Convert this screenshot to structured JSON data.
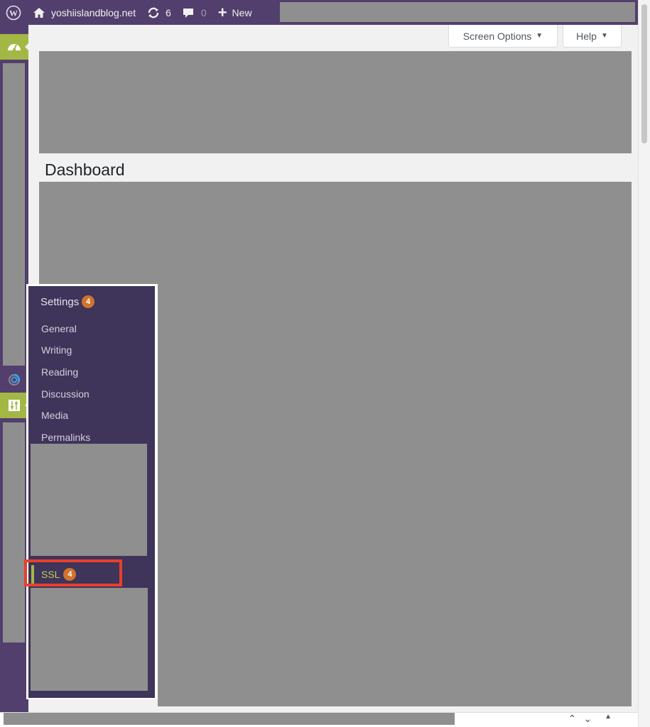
{
  "admin_bar": {
    "wp_logo_icon": "wordpress-logo-icon",
    "site_name": "yoshiislandblog.net",
    "updates_count": "6",
    "comments_count": "0",
    "new_label": "New"
  },
  "screen_meta": {
    "screen_options_label": "Screen Options",
    "help_label": "Help",
    "caret": "▼"
  },
  "page": {
    "title": "Dashboard"
  },
  "flyout": {
    "title": "Settings",
    "title_badge": "4",
    "items": [
      "General",
      "Writing",
      "Reading",
      "Discussion",
      "Media",
      "Permalinks"
    ],
    "ssl_label": "SSL",
    "ssl_badge": "4"
  },
  "browser_nav": {
    "up": "⌃",
    "down": "⌄",
    "top": "▲"
  },
  "colors": {
    "admin_bar": "#523f6d",
    "accent": "#a3b745",
    "flyout_bg": "#3f3459",
    "badge": "#d1732c",
    "highlight": "#e8402a"
  }
}
